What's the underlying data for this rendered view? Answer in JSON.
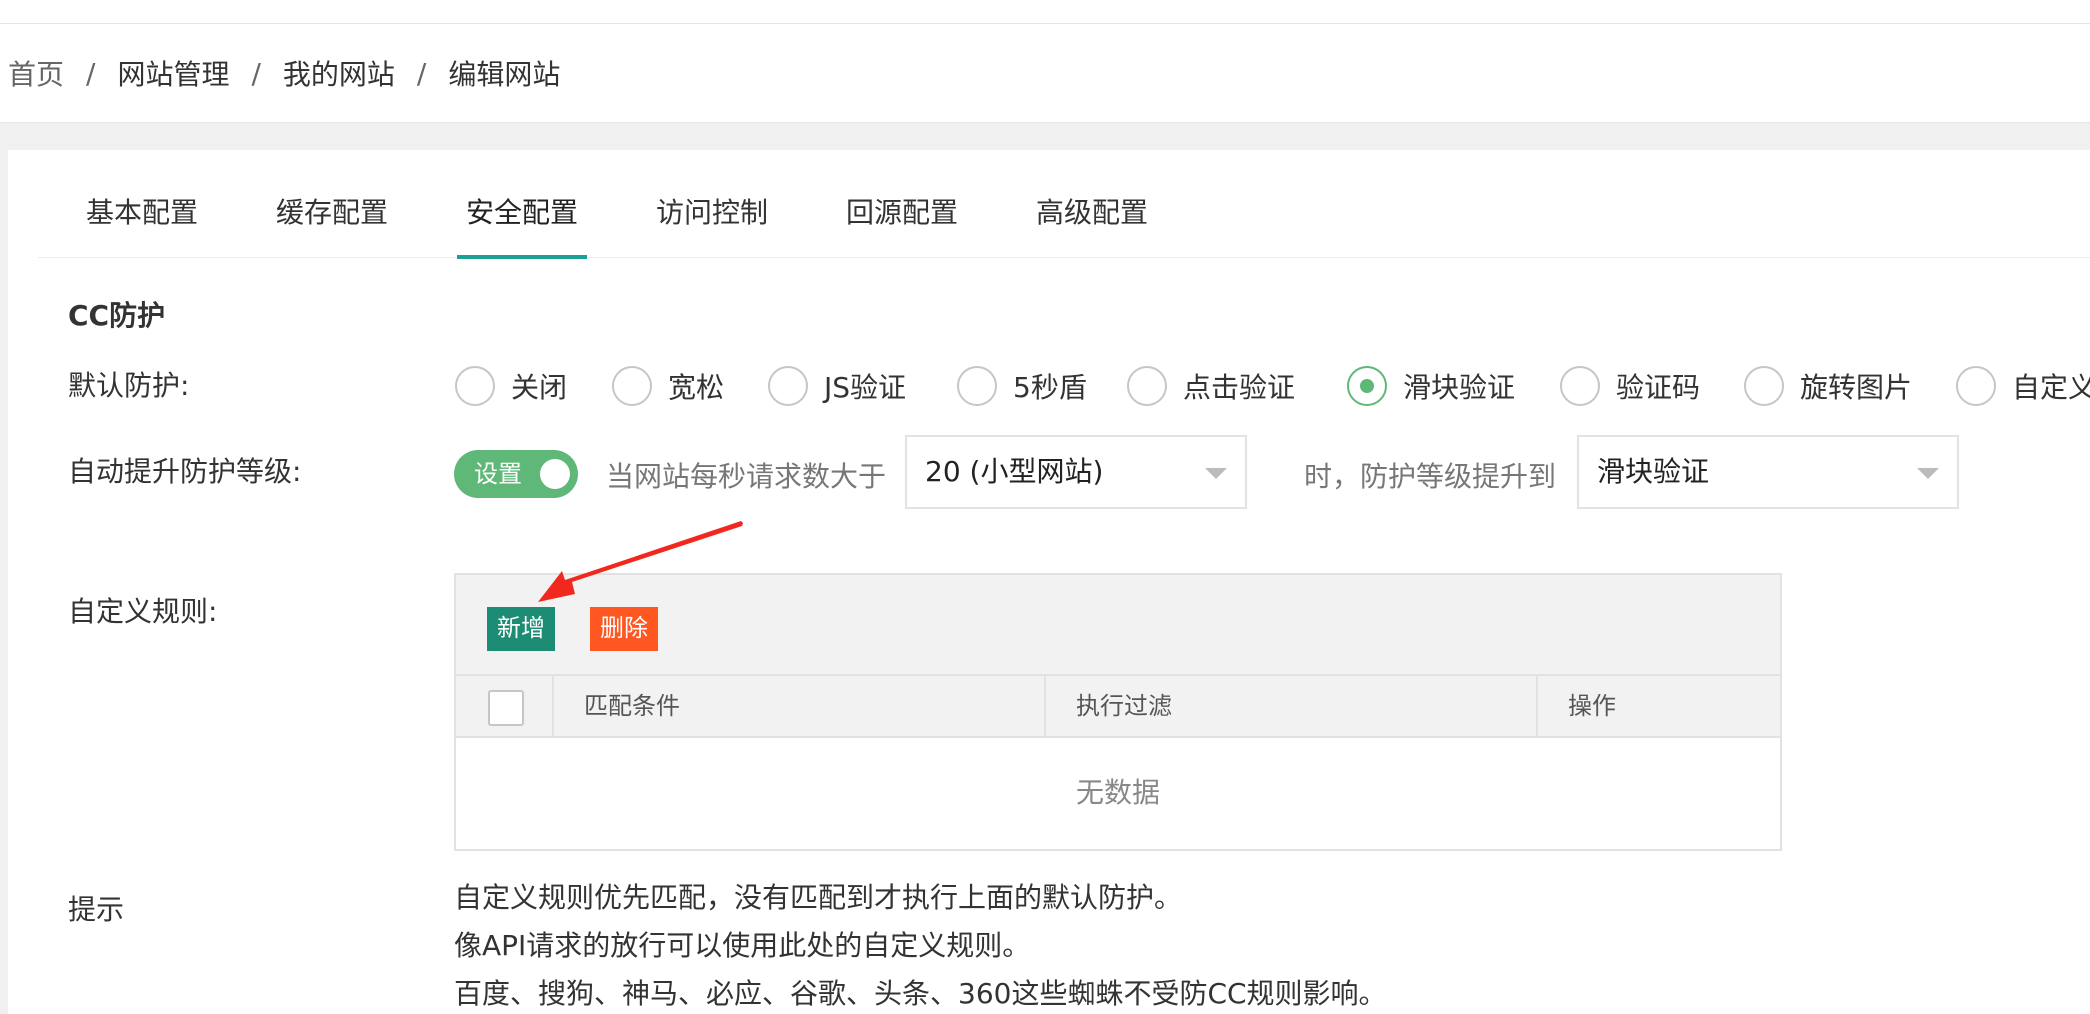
{
  "breadcrumb": [
    "首页",
    "网站管理",
    "我的网站",
    "编辑网站"
  ],
  "breadcrumb_sep": "/",
  "tabs": [
    "基本配置",
    "缓存配置",
    "安全配置",
    "访问控制",
    "回源配置",
    "高级配置"
  ],
  "active_tab": "安全配置",
  "cc": {
    "title": "CC防护",
    "default_label": "默认防护:",
    "options": [
      "关闭",
      "宽松",
      "JS验证",
      "5秒盾",
      "点击验证",
      "滑块验证",
      "验证码",
      "旋转图片",
      "自定义"
    ],
    "selected": "滑块验证",
    "auto_label": "自动提升防护等级:",
    "switch_label": "设置",
    "switch_on": true,
    "when_text": "当网站每秒请求数大于",
    "threshold_select": "20 (小型网站)",
    "then_text": "时，防护等级提升到",
    "level_select": "滑块验证",
    "rules_label": "自定义规则:",
    "add_button": "新增",
    "delete_button": "删除",
    "columns": [
      "匹配条件",
      "执行过滤",
      "操作"
    ],
    "empty_text": "无数据",
    "hint_label": "提示",
    "hints": [
      "自定义规则优先匹配，没有匹配到才执行上面的默认防护。",
      "像API请求的放行可以使用此处的自定义规则。",
      "百度、搜狗、神马、必应、谷歌、头条、360这些蜘蛛不受防CC规则影响。"
    ]
  },
  "colors": {
    "accent": "#5fb878",
    "tab_underline": "#1aa094",
    "add_button": "#1c8c75",
    "delete_button": "#ff5722",
    "annotation_arrow": "#f0281e"
  },
  "icons": {
    "caret": "chevron-down-icon",
    "annotation": "red-arrow-icon"
  }
}
